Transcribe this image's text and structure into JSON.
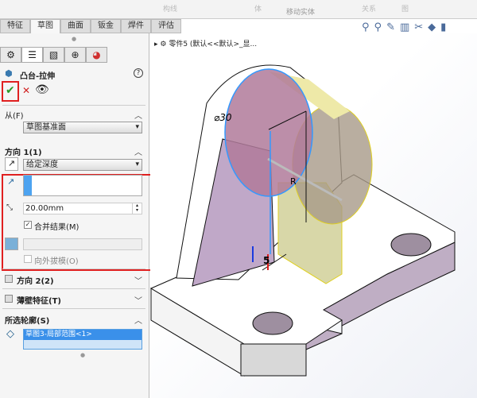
{
  "ribbon": {
    "items": [
      "构线",
      "体",
      "移动实体",
      "关系",
      "图"
    ]
  },
  "tabs": [
    "特征",
    "草图",
    "曲面",
    "钣金",
    "焊件",
    "评估"
  ],
  "active_tab": 1,
  "tree": {
    "label": "零件5 (默认<<默认>_显..."
  },
  "panel": {
    "title": "凸台-拉伸",
    "help": "?",
    "from": {
      "header": "从(F)",
      "value": "草图基准面"
    },
    "dir1": {
      "header": "方向 1(1)",
      "end": "给定深度",
      "depth": "20.00mm",
      "merge": "合并结果(M)",
      "merge_checked": true,
      "draft": "向外拔模(O)"
    },
    "dir2": {
      "header": "方向 2(2)"
    },
    "thin": {
      "header": "薄壁特征(T)"
    },
    "contours": {
      "header": "所选轮廓(S)",
      "item": "草图3-局部范围<1>"
    }
  },
  "dims": {
    "dia": "⌀30",
    "len": "5",
    "r": "R"
  },
  "colors": {
    "accent": "#3399ff",
    "highlight": "#e02020"
  }
}
